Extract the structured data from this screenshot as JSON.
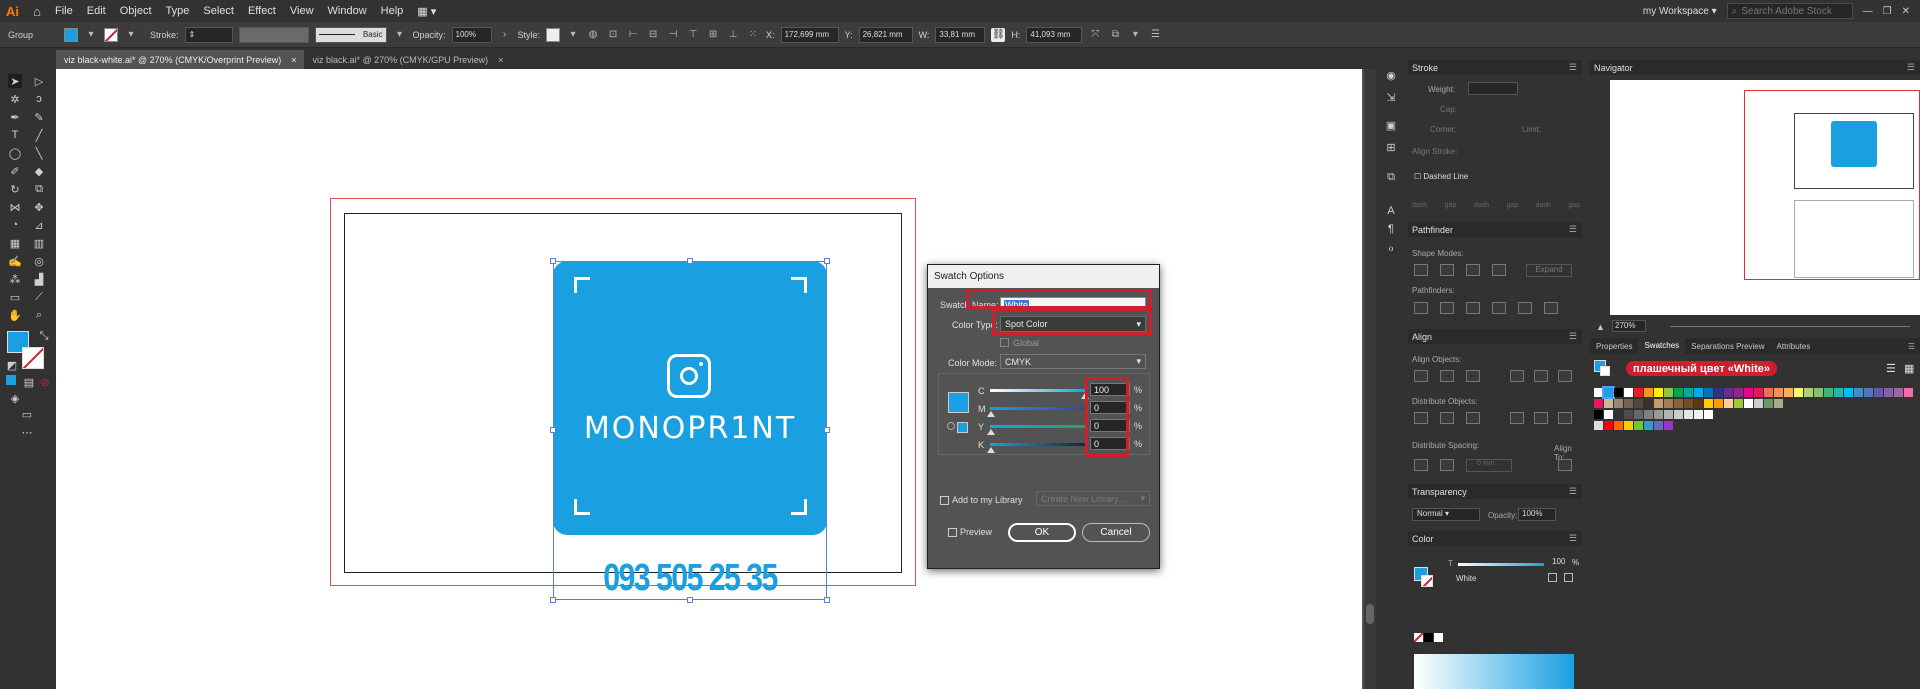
{
  "app": {
    "logo": "Ai",
    "workspace": "my Workspace",
    "search_placeholder": "Search Adobe Stock"
  },
  "menu": [
    "File",
    "Edit",
    "Object",
    "Type",
    "Select",
    "Effect",
    "View",
    "Window",
    "Help"
  ],
  "control_bar": {
    "selection_type": "Group",
    "stroke_label": "Stroke:",
    "stroke_profile": "Basic",
    "opacity_label": "Opacity:",
    "opacity_value": "100%",
    "style_label": "Style:",
    "x_label": "X:",
    "x_value": "172,699 mm",
    "y_label": "Y:",
    "y_value": "26,821 mm",
    "w_label": "W:",
    "w_value": "33,81 mm",
    "h_label": "H:",
    "h_value": "41,093 mm"
  },
  "tabs": [
    {
      "label": "viz black-white.ai* @ 270% (CMYK/Overprint Preview)",
      "close": "×"
    },
    {
      "label": "viz black.ai* @ 270% (CMYK/GPU Preview)",
      "close": "×"
    }
  ],
  "artwork": {
    "brand": "MONOPR1NT",
    "phone": "093 505 25 35",
    "card_color": "#1aa0e0"
  },
  "dialog": {
    "title": "Swatch Options",
    "swatch_name_label": "Swatch Name:",
    "swatch_name_value": "White",
    "color_type_label": "Color Type:",
    "color_type_value": "Spot Color",
    "global_label": "Global",
    "color_mode_label": "Color Mode:",
    "color_mode_value": "CMYK",
    "channels": [
      {
        "name": "C",
        "value": "100",
        "unit": "%",
        "level": 1.0
      },
      {
        "name": "M",
        "value": "0",
        "unit": "%",
        "level": 0
      },
      {
        "name": "Y",
        "value": "0",
        "unit": "%",
        "level": 0
      },
      {
        "name": "K",
        "value": "0",
        "unit": "%",
        "level": 0
      }
    ],
    "add_library_label": "Add to my Library",
    "library_placeholder": "Create New Library...",
    "preview_label": "Preview",
    "ok_label": "OK",
    "cancel_label": "Cancel"
  },
  "panels": {
    "stroke": {
      "title": "Stroke",
      "weight_label": "Weight:",
      "cap_label": "Cap:",
      "corner_label": "Corner:",
      "limit_label": "Limit:",
      "align_label": "Align Stroke:",
      "dashed_label": "Dashed Line",
      "dash_labels": [
        "dash",
        "gap",
        "dash",
        "gap",
        "dash",
        "gap"
      ]
    },
    "pathfinder": {
      "title": "Pathfinder",
      "shape_modes_label": "Shape Modes:",
      "expand_label": "Expand",
      "pathfinders_label": "Pathfinders:"
    },
    "align": {
      "title": "Align",
      "align_objects_label": "Align Objects:",
      "distribute_objects_label": "Distribute Objects:",
      "distribute_spacing_label": "Distribute Spacing:",
      "align_to_label": "Align To:",
      "spacing_value": "0 mm"
    },
    "transparency": {
      "title": "Transparency",
      "blend_mode": "Normal",
      "opacity_label": "Opacity:",
      "opacity_value": "100%"
    },
    "color": {
      "title": "Color",
      "channel": "T",
      "value": "100",
      "unit": "%",
      "swatch_name": "White"
    },
    "navigator": {
      "title": "Navigator",
      "zoom": "270%"
    },
    "tabs": [
      "Properties",
      "Swatches",
      "Separations Preview",
      "Attributes"
    ],
    "active_tab": "Swatches",
    "annotation": "плашечный цвет «White»"
  },
  "colors": {
    "accent_red": "#d01f2c",
    "cyan": "#1aa0e0"
  }
}
